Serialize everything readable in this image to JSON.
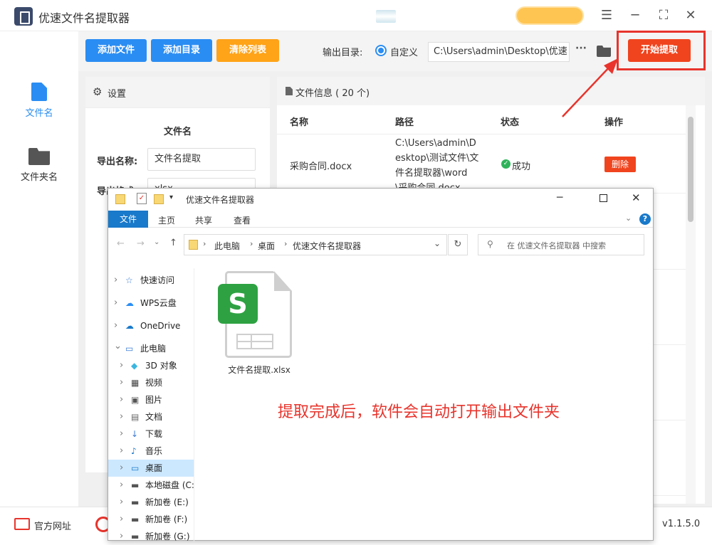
{
  "app": {
    "title": "优速文件名提取器",
    "version": "v1.1.5.0"
  },
  "sidebar": {
    "items": [
      {
        "label": "文件名"
      },
      {
        "label": "文件夹名"
      }
    ]
  },
  "toolbar": {
    "add_file": "添加文件",
    "add_dir": "添加目录",
    "clear": "清除列表",
    "output_label": "输出目录:",
    "custom_label": "自定义",
    "output_path": "C:\\Users\\admin\\Desktop\\优速",
    "more": "···",
    "start": "开始提取"
  },
  "settings": {
    "header": "设置",
    "section": "文件名",
    "export_name_label": "导出名称:",
    "export_name_value": "文件名提取",
    "export_format_label": "导出格式:",
    "export_format_value": "xlsx"
  },
  "fileinfo": {
    "header": "文件信息 ( 20 个)",
    "columns": [
      "名称",
      "路径",
      "状态",
      "操作"
    ],
    "row": {
      "name": "采购合同.docx",
      "path": "C:\\Users\\admin\\Desktop\\测试文件\\文件名提取器\\word\\采购合同.docx",
      "status": "成功",
      "action": "删除"
    }
  },
  "footer": {
    "website": "官方网址"
  },
  "explorer": {
    "title": "优速文件名提取器",
    "ribbon": [
      "文件",
      "主页",
      "共享",
      "查看"
    ],
    "breadcrumb": [
      "此电脑",
      "桌面",
      "优速文件名提取器"
    ],
    "search_placeholder": "在 优速文件名提取器 中搜索",
    "tree": [
      "快速访问",
      "WPS云盘",
      "OneDrive",
      "此电脑",
      "3D 对象",
      "视频",
      "图片",
      "文档",
      "下载",
      "音乐",
      "桌面",
      "本地磁盘 (C:",
      "新加卷 (E:)",
      "新加卷 (F:)",
      "新加卷 (G:)"
    ],
    "file": {
      "name": "文件名提取.xlsx",
      "badge": "S"
    }
  },
  "annotation": "提取完成后，软件会自动打开输出文件夹",
  "colors": {
    "blue": "#2a8df3",
    "orange": "#ffa318",
    "red": "#f0441e",
    "annotation": "#e8342c"
  }
}
